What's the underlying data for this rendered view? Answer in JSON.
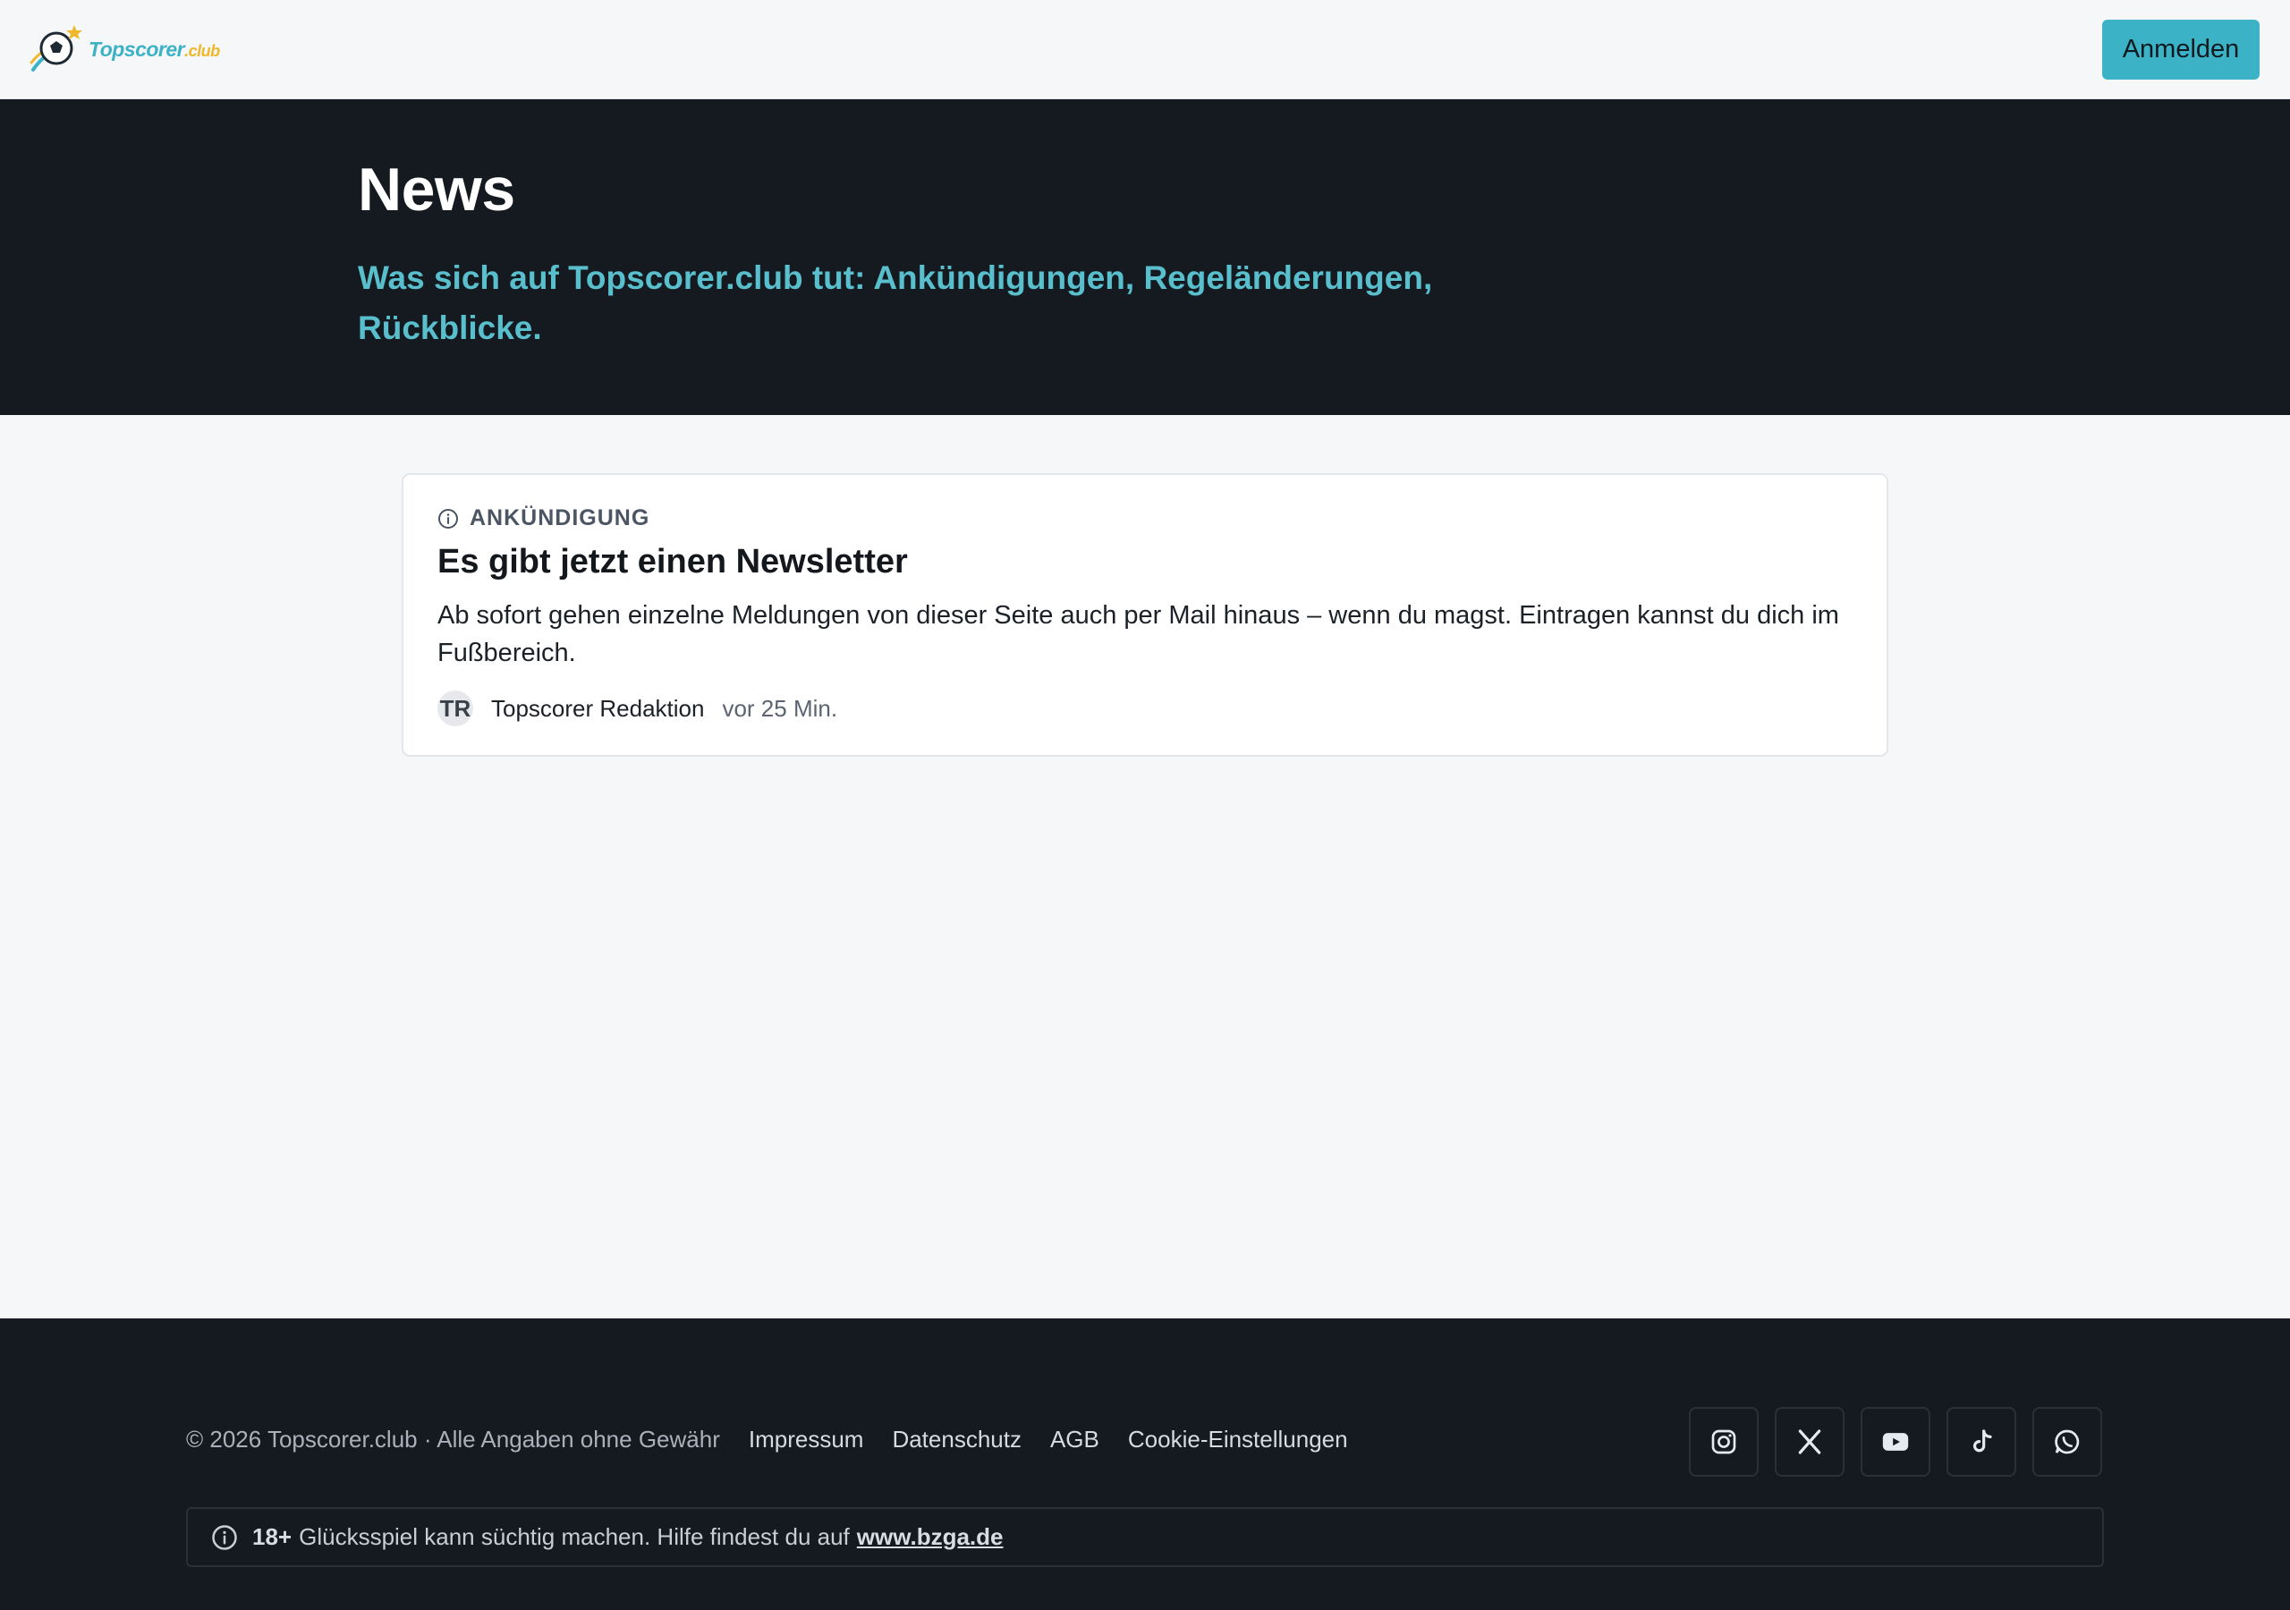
{
  "header": {
    "logo_text": "Topscorer",
    "logo_suffix": ".club",
    "login_label": "Anmelden"
  },
  "hero": {
    "title": "News",
    "subtitle": "Was sich auf Topscorer.club tut: Ankündigungen, Regeländerungen, Rückblicke."
  },
  "posts": [
    {
      "category": "ANKÜNDIGUNG",
      "title": "Es gibt jetzt einen Newsletter",
      "excerpt": "Ab sofort gehen einzelne Meldungen von dieser Seite auch per Mail hinaus – wenn du magst. Eintragen kannst du dich im Fußbereich.",
      "author_initials": "TR",
      "author": "Topscorer Redaktion",
      "time": "vor 25 Min."
    }
  ],
  "footer": {
    "copyright": "© 2026 Topscorer.club · Alle Angaben ohne Gewähr",
    "links": [
      "Impressum",
      "Datenschutz",
      "AGB",
      "Cookie-Einstellungen"
    ],
    "socials": [
      "instagram-icon",
      "x-icon",
      "youtube-icon",
      "tiktok-icon",
      "whatsapp-icon"
    ],
    "notice_age": "18+",
    "notice_text": "Glücksspiel kann süchtig machen. Hilfe findest du auf",
    "notice_link": "www.bzga.de"
  },
  "colors": {
    "accent": "#3bb2c6",
    "dark": "#151a20",
    "subtitle": "#59bfcd",
    "logo_gold": "#f0b72a"
  }
}
